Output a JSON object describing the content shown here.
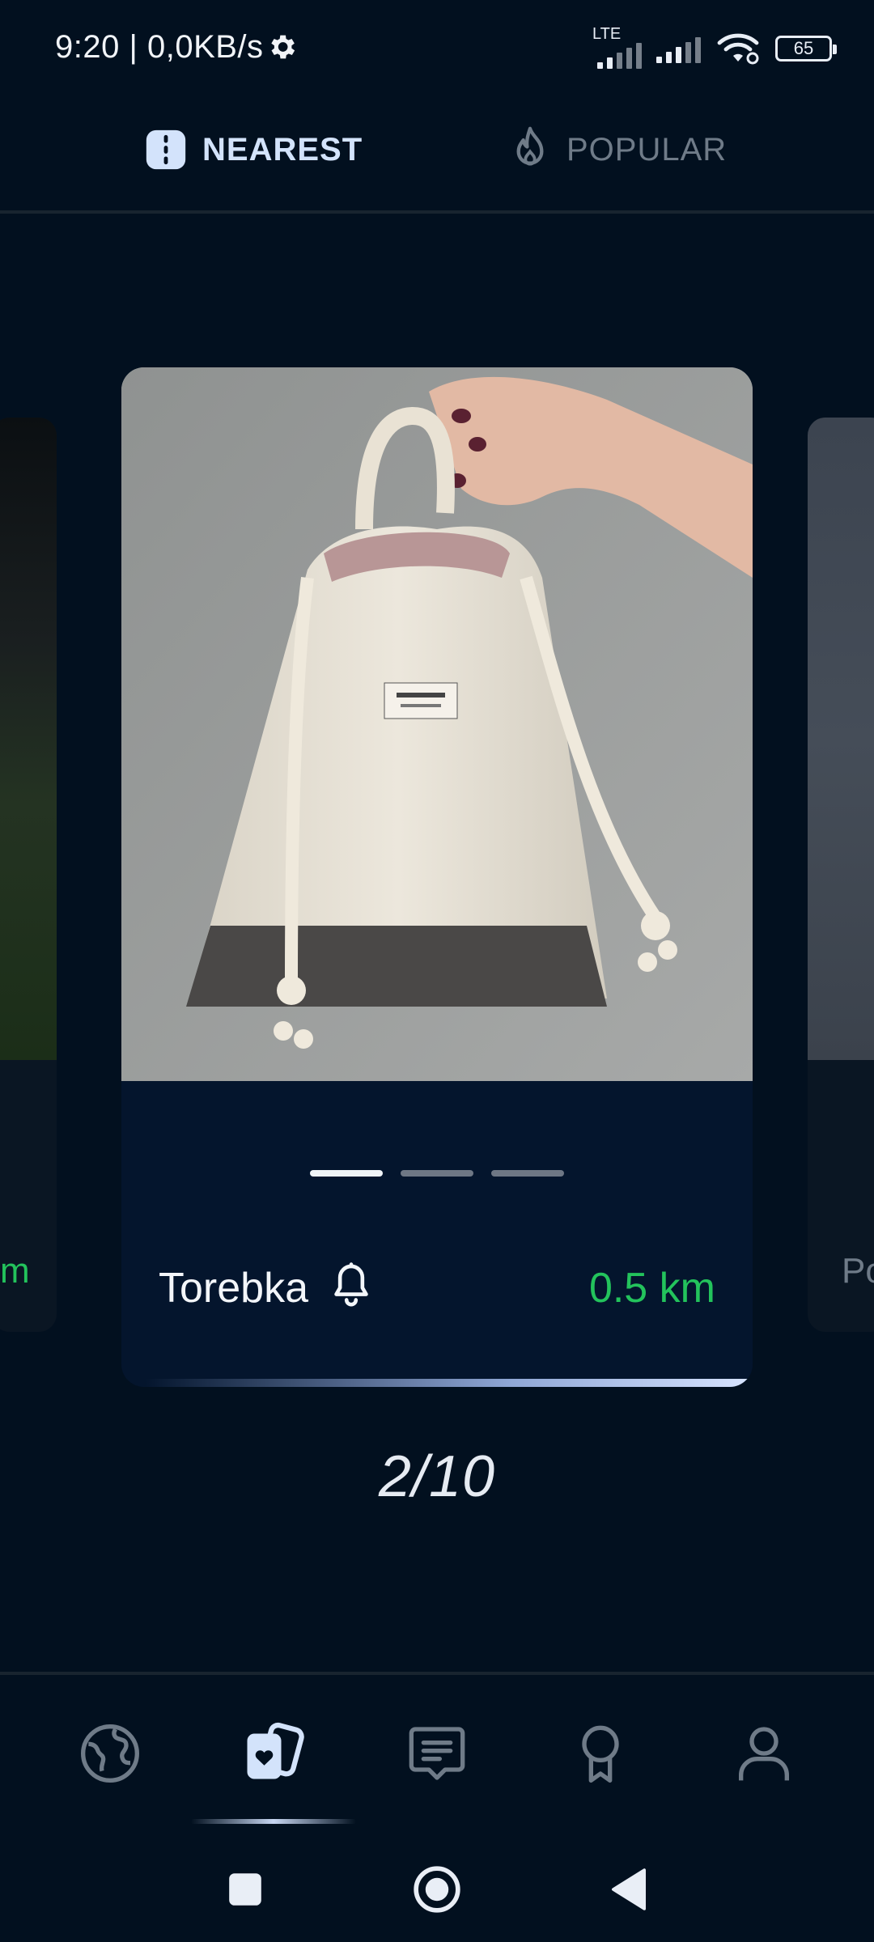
{
  "status": {
    "time_speed": "9:20 | 0,0KB/s",
    "network": "LTE",
    "battery": "65"
  },
  "tabs": {
    "nearest": "NEAREST",
    "popular": "POPULAR",
    "active": "nearest"
  },
  "carousel": {
    "card": {
      "name": "Torebka",
      "distance": "0.5 km",
      "image_pages": 3,
      "active_page": 1
    },
    "left_peek_text": "m",
    "right_peek_text": "Po",
    "counter": "2/10"
  },
  "bottom_nav": {
    "items": [
      "globe-icon",
      "cards-heart-icon",
      "message-icon",
      "award-icon",
      "profile-icon"
    ],
    "active_index": 1
  },
  "colors": {
    "background": "#02101f",
    "card": "#04152d",
    "accent_active": "#d3e3fb",
    "distance_green": "#23c35c",
    "inactive": "#6f7b88"
  }
}
